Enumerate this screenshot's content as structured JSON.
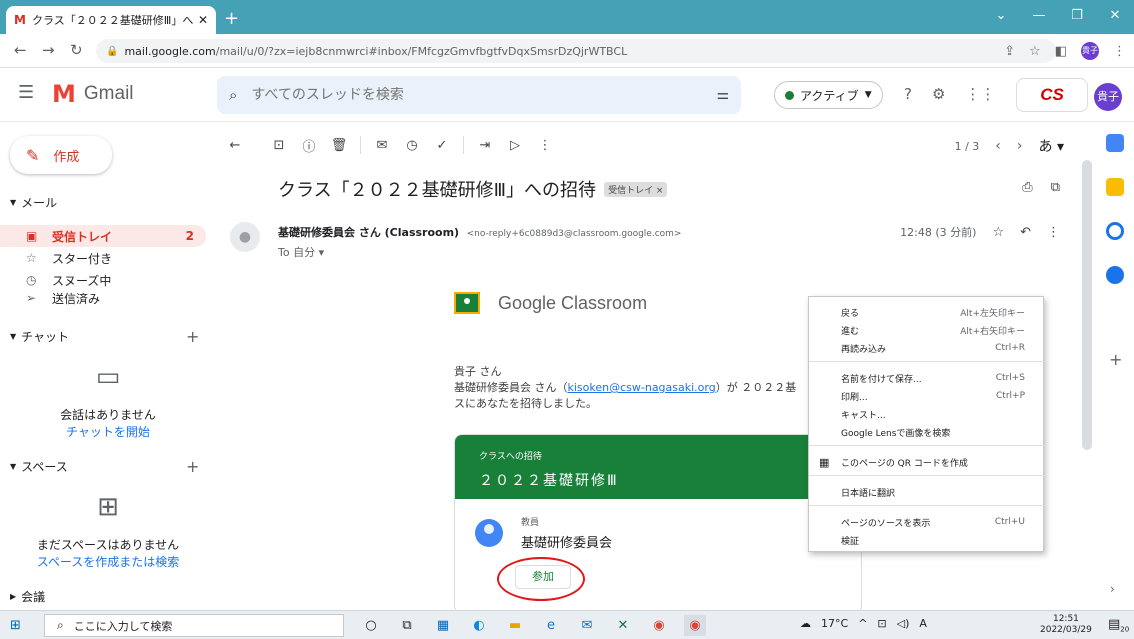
{
  "browser": {
    "tab_title": "クラス「２０２２基礎研修Ⅲ」への招",
    "url_host": "mail.google.com",
    "url_path": "/mail/u/0/?zx=iejb8cnmwrci#inbox/FMfcgzGmvfbgtfvDqxSmsrDzQjrWTBCL",
    "tab_avatar": "貴子"
  },
  "gmail": {
    "app_name": "Gmail",
    "search_placeholder": "すべてのスレッドを検索",
    "status": "アクティブ",
    "org_logo": "CS",
    "avatar": "貴子"
  },
  "leftnav": {
    "compose": "作成",
    "mail_section": "メール",
    "items": [
      {
        "label": "受信トレイ",
        "count": "2"
      },
      {
        "label": "スター付き",
        "count": ""
      },
      {
        "label": "スヌーズ中",
        "count": ""
      },
      {
        "label": "送信済み",
        "count": ""
      }
    ],
    "chat_section": "チャット",
    "chat_empty": "会話はありません",
    "chat_link": "チャットを開始",
    "spaces_section": "スペース",
    "spaces_empty": "まだスペースはありません",
    "spaces_link": "スペースを作成または検索",
    "meet_section": "会議"
  },
  "toolbar": {
    "pager": "1 / 3",
    "lang": "あ"
  },
  "email": {
    "subject": "クラス「２０２２基礎研修Ⅲ」への招待",
    "label": "受信トレイ ×",
    "sender_name": "基礎研修委員会 さん (Classroom)",
    "sender_addr": "<no-reply+6c0889d3@classroom.google.com>",
    "to": "To 自分 ▾",
    "time": "12:48 (3 分前)",
    "classroom_title": "Google Classroom",
    "greeting": "貴子 さん",
    "body_pre": "基礎研修委員会 さん（",
    "body_email": "kisoken@csw-nagasaki.org",
    "body_post": "）が ２０２２基",
    "body_line2": "スにあなたを招待しました。",
    "invite_small": "クラスへの招待",
    "invite_class": "２０２２基礎研修Ⅲ",
    "teacher_role": "教員",
    "teacher_name": "基礎研修委員会",
    "join_label": "参加"
  },
  "context_menu": [
    {
      "label": "戻る",
      "shortcut": "Alt+左矢印キー"
    },
    {
      "label": "進む",
      "shortcut": "Alt+右矢印キー"
    },
    {
      "label": "再読み込み",
      "shortcut": "Ctrl+R"
    },
    {
      "label": "名前を付けて保存...",
      "shortcut": "Ctrl+S"
    },
    {
      "label": "印刷...",
      "shortcut": "Ctrl+P"
    },
    {
      "label": "キャスト...",
      "shortcut": ""
    },
    {
      "label": "Google Lensで画像を検索",
      "shortcut": ""
    },
    {
      "label": "このページの QR コードを作成",
      "shortcut": ""
    },
    {
      "label": "日本語に翻訳",
      "shortcut": ""
    },
    {
      "label": "ページのソースを表示",
      "shortcut": "Ctrl+U"
    },
    {
      "label": "検証",
      "shortcut": ""
    }
  ],
  "taskbar": {
    "search": "ここに入力して検索",
    "weather": "17°C",
    "ime": "A",
    "time": "12:51",
    "date": "2022/03/29",
    "notif_count": "20"
  },
  "colors": {
    "tab_strip": "#45a1b6",
    "gmail_red": "#d93025",
    "classroom_green": "#188038",
    "highlight_oval": "#e01818"
  }
}
